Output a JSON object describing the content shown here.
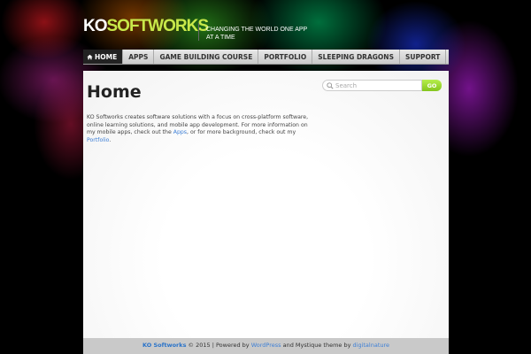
{
  "header": {
    "logo_ko": "KO",
    "logo_softworks": "SOFTWORKS",
    "tagline": "CHANGING THE WORLD ONE APP AT A TIME"
  },
  "nav": {
    "items": [
      {
        "label": "HOME",
        "active": true
      },
      {
        "label": "APPS"
      },
      {
        "label": "GAME BUILDING COURSE"
      },
      {
        "label": "PORTFOLIO"
      },
      {
        "label": "SLEEPING DRAGONS"
      },
      {
        "label": "SUPPORT"
      }
    ]
  },
  "search": {
    "placeholder": "Search",
    "go_label": "GO"
  },
  "page": {
    "title": "Home",
    "intro_part1": "KO Softworks creates software solutions with a focus on cross-platform software, online learning solutions, and mobile app development. For more information on my mobile apps, check out the ",
    "apps_link": "Apps",
    "intro_part2": ", or for more background, check out my ",
    "portfolio_link": "Portfolio",
    "intro_part3": "."
  },
  "footer": {
    "brand": "KO Softworks",
    "copyright": "© 2015 | Powered by ",
    "wordpress": "WordPress",
    "mid": " and Mystique theme by ",
    "theme_author": "digitalnature"
  },
  "colors": {
    "accent_green": "#c8e84a",
    "link_blue": "#3d7fd6",
    "go_green": "#84c51e"
  }
}
